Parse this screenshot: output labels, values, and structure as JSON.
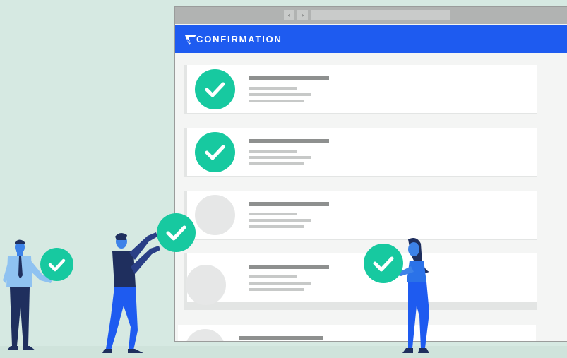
{
  "app": {
    "brand_name": "CONFIRMATION",
    "brand_color": "#1e5bf0",
    "check_color": "#17c9a0",
    "background_color": "#d6e9e2"
  },
  "toolbar": {
    "back_icon": "chevron-left-icon",
    "forward_icon": "chevron-right-icon",
    "back_glyph": "‹",
    "forward_glyph": "›"
  },
  "list": {
    "items": [
      {
        "status": "confirmed"
      },
      {
        "status": "confirmed"
      },
      {
        "status": "pending"
      },
      {
        "status": "pending"
      },
      {
        "status": "pending"
      }
    ]
  },
  "illustration": {
    "people": [
      "person-with-tie",
      "person-reaching-up",
      "woman-holding-check"
    ],
    "floating_checks": 3
  }
}
